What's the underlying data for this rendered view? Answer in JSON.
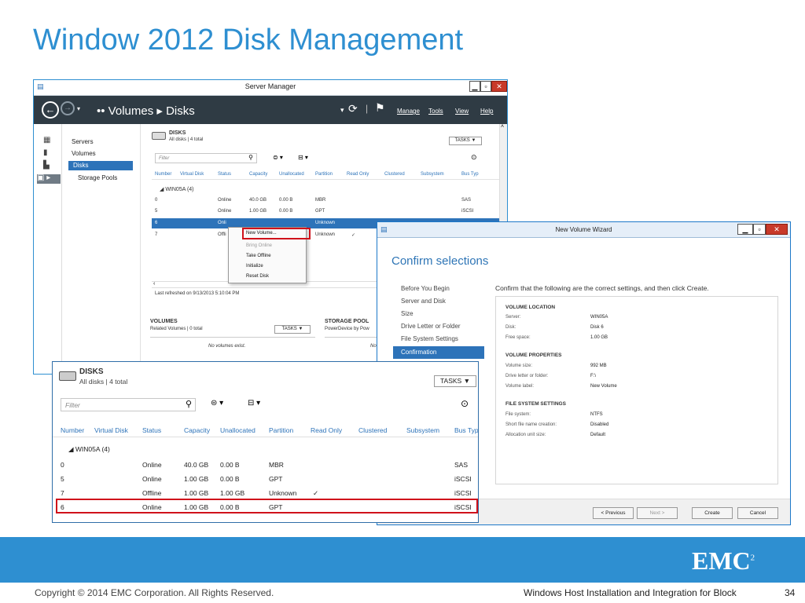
{
  "slide": {
    "title": "Window 2012 Disk Management",
    "copyright": "Copyright © 2014 EMC Corporation. All Rights Reserved.",
    "footer_title": "Windows Host Installation and Integration for Block",
    "page_number": "34",
    "logo_text": "EMC",
    "logo_superscript": "2",
    "accent_color": "#2e8fd1"
  },
  "server_manager": {
    "window_title": "Server Manager",
    "breadcrumb": "•• Volumes ▸ Disks",
    "menus": [
      "Manage",
      "Tools",
      "View",
      "Help"
    ],
    "nav": [
      "Servers",
      "Volumes",
      "Disks",
      "Storage Pools"
    ],
    "disks_title": "DISKS",
    "disks_sub": "All disks | 4 total",
    "tasks": "TASKS",
    "filter_placeholder": "Filter",
    "columns": [
      "Number",
      "Virtual Disk",
      "Status",
      "Capacity",
      "Unallocated",
      "Partition",
      "Read Only",
      "Clustered",
      "Subsystem",
      "Bus Typ"
    ],
    "group": "WIN05A (4)",
    "rows": [
      {
        "number": "0",
        "status": "Online",
        "capacity": "40.0 GB",
        "unallocated": "0.00 B",
        "partition": "MBR",
        "readonly": "",
        "bus": "SAS"
      },
      {
        "number": "5",
        "status": "Online",
        "capacity": "1.00 GB",
        "unallocated": "0.00 B",
        "partition": "GPT",
        "readonly": "",
        "bus": "iSCSI"
      },
      {
        "number": "6",
        "status": "Onli",
        "capacity": "",
        "unallocated": "",
        "partition": "Unknown",
        "readonly": "",
        "bus": ""
      },
      {
        "number": "7",
        "status": "Offli",
        "capacity": "",
        "unallocated": "",
        "partition": "Unknown",
        "readonly": "✓",
        "bus": ""
      }
    ],
    "refreshed": "Last refreshed on 9/13/2013 5:10:04 PM",
    "volumes_title": "VOLUMES",
    "volumes_sub": "Related Volumes | 0 total",
    "volumes_empty": "No volumes exist.",
    "pool_title": "STORAGE POOL",
    "pool_sub": "PowerDevice by Pow",
    "pool_empty": "No",
    "context_menu": [
      "New Volume...",
      "Bring Online",
      "Take Offline",
      "Initialize",
      "Reset Disk"
    ]
  },
  "wizard": {
    "window_title": "New Volume Wizard",
    "heading": "Confirm selections",
    "steps": [
      "Before You Begin",
      "Server and Disk",
      "Size",
      "Drive Letter or Folder",
      "File System Settings",
      "Confirmation"
    ],
    "intro": "Confirm that the following are the correct settings, and then click Create.",
    "sections": [
      {
        "title": "VOLUME LOCATION",
        "items": [
          [
            "Server:",
            "WIN05A"
          ],
          [
            "Disk:",
            "Disk 6"
          ],
          [
            "Free space:",
            "1.00 GB"
          ]
        ]
      },
      {
        "title": "VOLUME PROPERTIES",
        "items": [
          [
            "Volume size:",
            "992 MB"
          ],
          [
            "Drive letter or folder:",
            "F:\\"
          ],
          [
            "Volume label:",
            "New Volume"
          ]
        ]
      },
      {
        "title": "FILE SYSTEM SETTINGS",
        "items": [
          [
            "File system:",
            "NTFS"
          ],
          [
            "Short file name creation:",
            "Disabled"
          ],
          [
            "Allocation unit size:",
            "Default"
          ]
        ]
      }
    ],
    "buttons": {
      "previous": "< Previous",
      "next": "Next >",
      "create": "Create",
      "cancel": "Cancel"
    }
  },
  "zoom": {
    "title": "DISKS",
    "sub": "All disks | 4 total",
    "tasks": "TASKS",
    "filter_placeholder": "Filter",
    "columns": [
      "Number",
      "Virtual Disk",
      "Status",
      "Capacity",
      "Unallocated",
      "Partition",
      "Read Only",
      "Clustered",
      "Subsystem",
      "Bus Typ"
    ],
    "group": "WIN05A (4)",
    "rows": [
      {
        "number": "0",
        "status": "Online",
        "capacity": "40.0 GB",
        "unallocated": "0.00 B",
        "partition": "MBR",
        "readonly": "",
        "bus": "SAS"
      },
      {
        "number": "5",
        "status": "Online",
        "capacity": "1.00 GB",
        "unallocated": "0.00 B",
        "partition": "GPT",
        "readonly": "",
        "bus": "iSCSI"
      },
      {
        "number": "7",
        "status": "Offline",
        "capacity": "1.00 GB",
        "unallocated": "1.00 GB",
        "partition": "Unknown",
        "readonly": "✓",
        "bus": "iSCSI"
      },
      {
        "number": "6",
        "status": "Online",
        "capacity": "1.00 GB",
        "unallocated": "0.00 B",
        "partition": "GPT",
        "readonly": "",
        "bus": "iSCSI"
      }
    ]
  }
}
